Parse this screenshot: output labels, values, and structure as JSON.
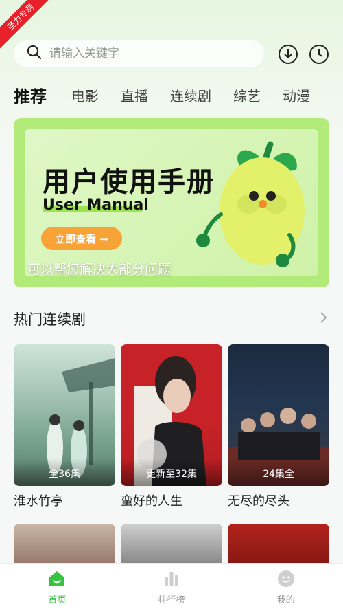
{
  "ribbon": "圣力专测",
  "search": {
    "placeholder": "请输入关键字"
  },
  "tabs": [
    {
      "label": "推荐",
      "active": true
    },
    {
      "label": "电影"
    },
    {
      "label": "直播"
    },
    {
      "label": "连续剧"
    },
    {
      "label": "综艺"
    },
    {
      "label": "动漫"
    }
  ],
  "banner": {
    "title": "用户使用手册",
    "subtitle": "User Manual",
    "cta": "立即查看 ➞",
    "caption": "可以帮您解决大部分问题"
  },
  "section": {
    "title": "热门连续剧"
  },
  "cards": [
    {
      "title": "淮水竹亭",
      "badge": "全36集"
    },
    {
      "title": "蛮好的人生",
      "badge": "更新至32集"
    },
    {
      "title": "无尽的尽头",
      "badge": "24集全"
    }
  ],
  "bottom_nav": [
    {
      "label": "首页",
      "icon": "home-icon",
      "active": true
    },
    {
      "label": "排行榜",
      "icon": "ranking-icon"
    },
    {
      "label": "我的",
      "icon": "profile-icon"
    }
  ],
  "colors": {
    "accent": "#36c33f",
    "ribbon": "#e8202a",
    "cta": "#f7a338",
    "banner": "#b3eb7a"
  }
}
